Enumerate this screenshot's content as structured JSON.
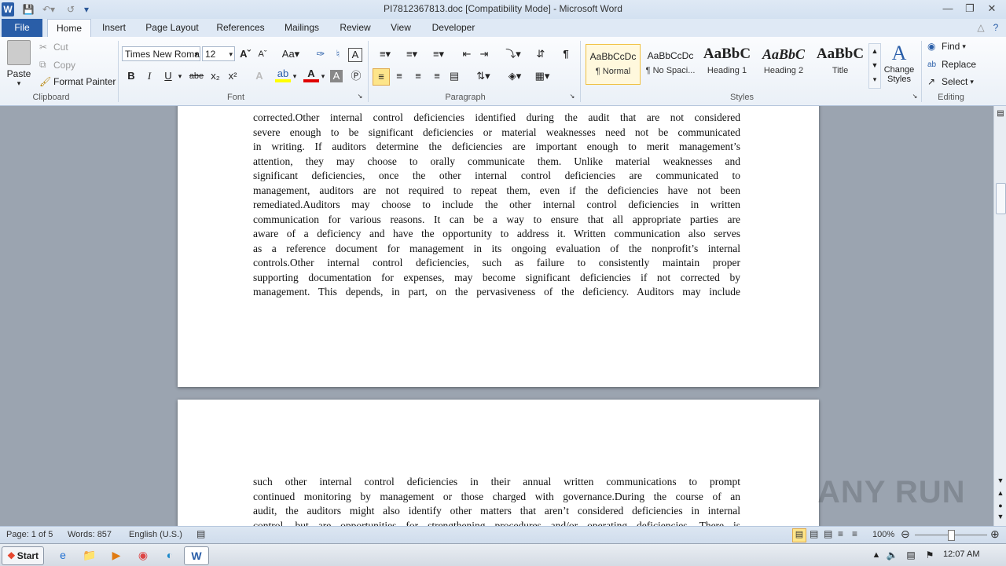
{
  "window": {
    "title": "PI7812367813.doc [Compatibility Mode]  -  Microsoft Word",
    "app_icon": "W"
  },
  "tabs": [
    "File",
    "Home",
    "Insert",
    "Page Layout",
    "References",
    "Mailings",
    "Review",
    "View",
    "Developer"
  ],
  "ribbon": {
    "clipboard": {
      "paste": "Paste",
      "cut": "Cut",
      "copy": "Copy",
      "format_painter": "Format Painter",
      "label": "Clipboard"
    },
    "font": {
      "name": "Times New Roma",
      "size": "12",
      "label": "Font",
      "bold": "B",
      "italic": "I",
      "underline": "U",
      "strike": "abe",
      "sub": "x₂",
      "sup": "x²"
    },
    "paragraph": {
      "label": "Paragraph"
    },
    "styles": {
      "label": "Styles",
      "items": [
        {
          "sample": "AaBbCcDc",
          "name": "¶ Normal"
        },
        {
          "sample": "AaBbCcDc",
          "name": "¶ No Spaci..."
        },
        {
          "sample": "AaBbC",
          "name": "Heading 1"
        },
        {
          "sample": "AaBbC",
          "name": "Heading 2"
        },
        {
          "sample": "AaBbC",
          "name": "Title"
        }
      ],
      "change_styles": "Change Styles"
    },
    "editing": {
      "find": "Find",
      "replace": "Replace",
      "select": "Select",
      "label": "Editing"
    }
  },
  "document": {
    "page1_lines": [
      "corrected.Other internal control deficiencies identified during the audit that are not considered",
      "severe enough to be significant deficiencies or material weaknesses need not be communicated",
      "in writing. If auditors determine the deficiencies are important enough to merit management’s",
      "attention, they may choose to orally communicate them. Unlike material weaknesses and",
      "significant deficiencies, once the other internal control deficiencies are communicated to",
      "management, auditors are not required to repeat them, even if the deficiencies have not been",
      "remediated.Auditors may choose to include the other internal control deficiencies in written",
      "communication for various reasons. It can be a way to ensure that all appropriate parties are",
      "aware of a deficiency and have the opportunity to address it. Written communication also serves",
      "as a reference document for management in its ongoing evaluation of the nonprofit’s internal",
      "controls.Other internal control deficiencies, such as failure to consistently maintain proper",
      "supporting documentation for expenses, may become significant deficiencies if not corrected by",
      "management. This depends, in part, on the pervasiveness of the deficiency. Auditors may include"
    ],
    "page2_lines": [
      "such other internal control deficiencies in their annual written communications to prompt",
      "continued monitoring by management or those charged with governance.During the course of an",
      "audit, the auditors might also identify other matters that aren’t considered deficiencies in internal",
      "control, but are opportunities for strengthening procedures and/or operating deficiencies. There is"
    ]
  },
  "statusbar": {
    "page": "Page: 1 of 5",
    "words": "Words: 857",
    "language": "English (U.S.)",
    "zoom": "100%"
  },
  "taskbar": {
    "start": "Start",
    "clock": "12:07 AM"
  },
  "watermark": "ANY RUN"
}
